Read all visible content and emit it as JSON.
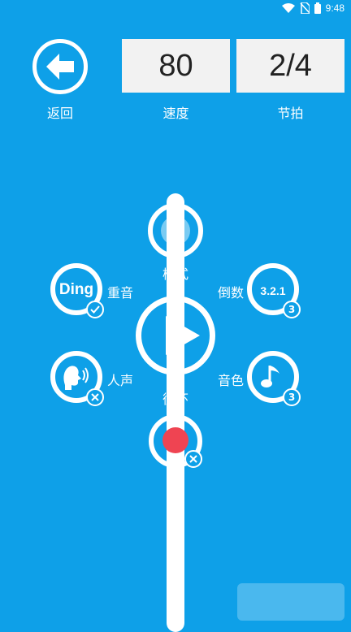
{
  "status": {
    "time": "9:48"
  },
  "header": {
    "back_label": "返回",
    "tempo_value": "80",
    "tempo_label": "速度",
    "beat_value": "2/4",
    "beat_label": "节拍"
  },
  "controls": {
    "mode_label": "模式",
    "accent_label": "重音",
    "accent_icon_text": "Ding",
    "countdown_label": "倒数",
    "countdown_icon_text": "3.2.1",
    "countdown_badge": "3",
    "voice_label": "人声",
    "timbre_label": "音色",
    "timbre_badge": "3",
    "repeat_label": "循环"
  },
  "colors": {
    "background": "#0ea0e8",
    "accent_red": "#ef4452"
  }
}
